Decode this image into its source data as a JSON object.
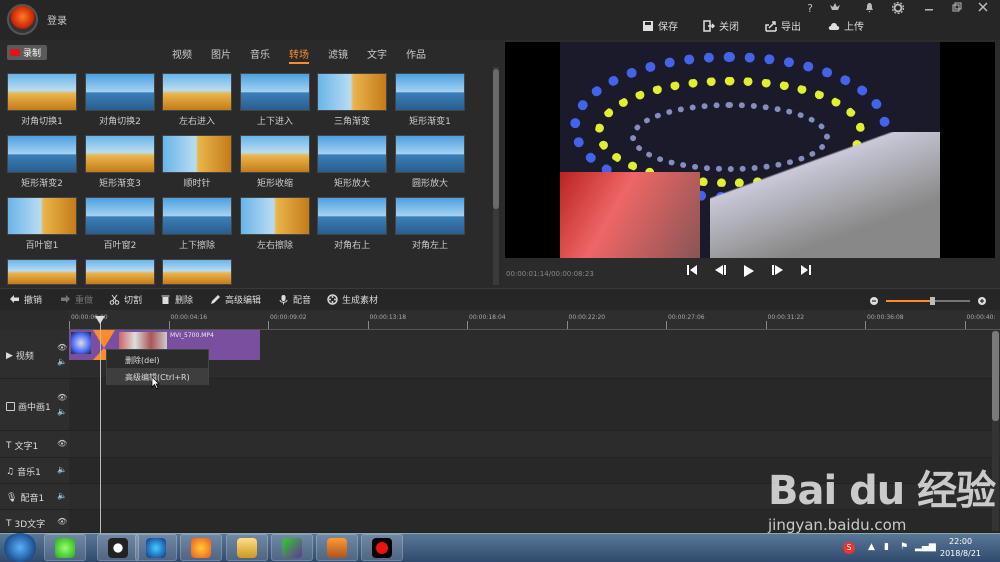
{
  "titlebar": {
    "login": "登录",
    "help": "?",
    "actions": {
      "save": "保存",
      "close": "关闭",
      "export": "导出",
      "upload": "上传"
    }
  },
  "left": {
    "record": "录制",
    "tabs": [
      "视频",
      "图片",
      "音乐",
      "转场",
      "滤镜",
      "文字",
      "作品"
    ],
    "active_tab": "转场",
    "transitions": [
      "对角切换1",
      "对角切换2",
      "左右进入",
      "上下进入",
      "三角渐变",
      "矩形渐变1",
      "矩形渐变2",
      "矩形渐变3",
      "顺时针",
      "矩形收缩",
      "矩形放大",
      "圆形放大",
      "百叶窗1",
      "百叶窗2",
      "上下擦除",
      "左右擦除",
      "对角右上",
      "对角左上"
    ]
  },
  "preview": {
    "timecode": "00:00:01:14/00:00:08:23"
  },
  "toolbar": {
    "undo": "撤销",
    "redo": "重做",
    "cut": "切割",
    "delete": "删除",
    "advanced": "高级编辑",
    "dub": "配音",
    "generate": "生成素材"
  },
  "ruler": {
    "ticks": [
      "00:00:00:00",
      "00:00:04:16",
      "00:00:09:02",
      "00:00:13:18",
      "00:00:18:04",
      "00:00:22:20",
      "00:00:27:06",
      "00:00:31:22",
      "00:00:36:08",
      "00:00:40:"
    ]
  },
  "tracks": {
    "video": "视频",
    "pip": "画中画1",
    "text": "文字1",
    "music": "音乐1",
    "voice": "配音1",
    "text3d": "3D文字"
  },
  "clip": {
    "name": "MVI_5700.MP4"
  },
  "context_menu": {
    "delete": "删除(del)",
    "advanced": "高级编辑(Ctrl+R)"
  },
  "taskbar": {
    "time": "22:00",
    "date": "2018/8/21"
  },
  "watermark": {
    "brand": "Bai du 经验",
    "url": "jingyan.baidu.com"
  },
  "colors": {
    "accent": "#ff8a2b",
    "clip": "#7a4fa0",
    "record": "#e8101a"
  }
}
